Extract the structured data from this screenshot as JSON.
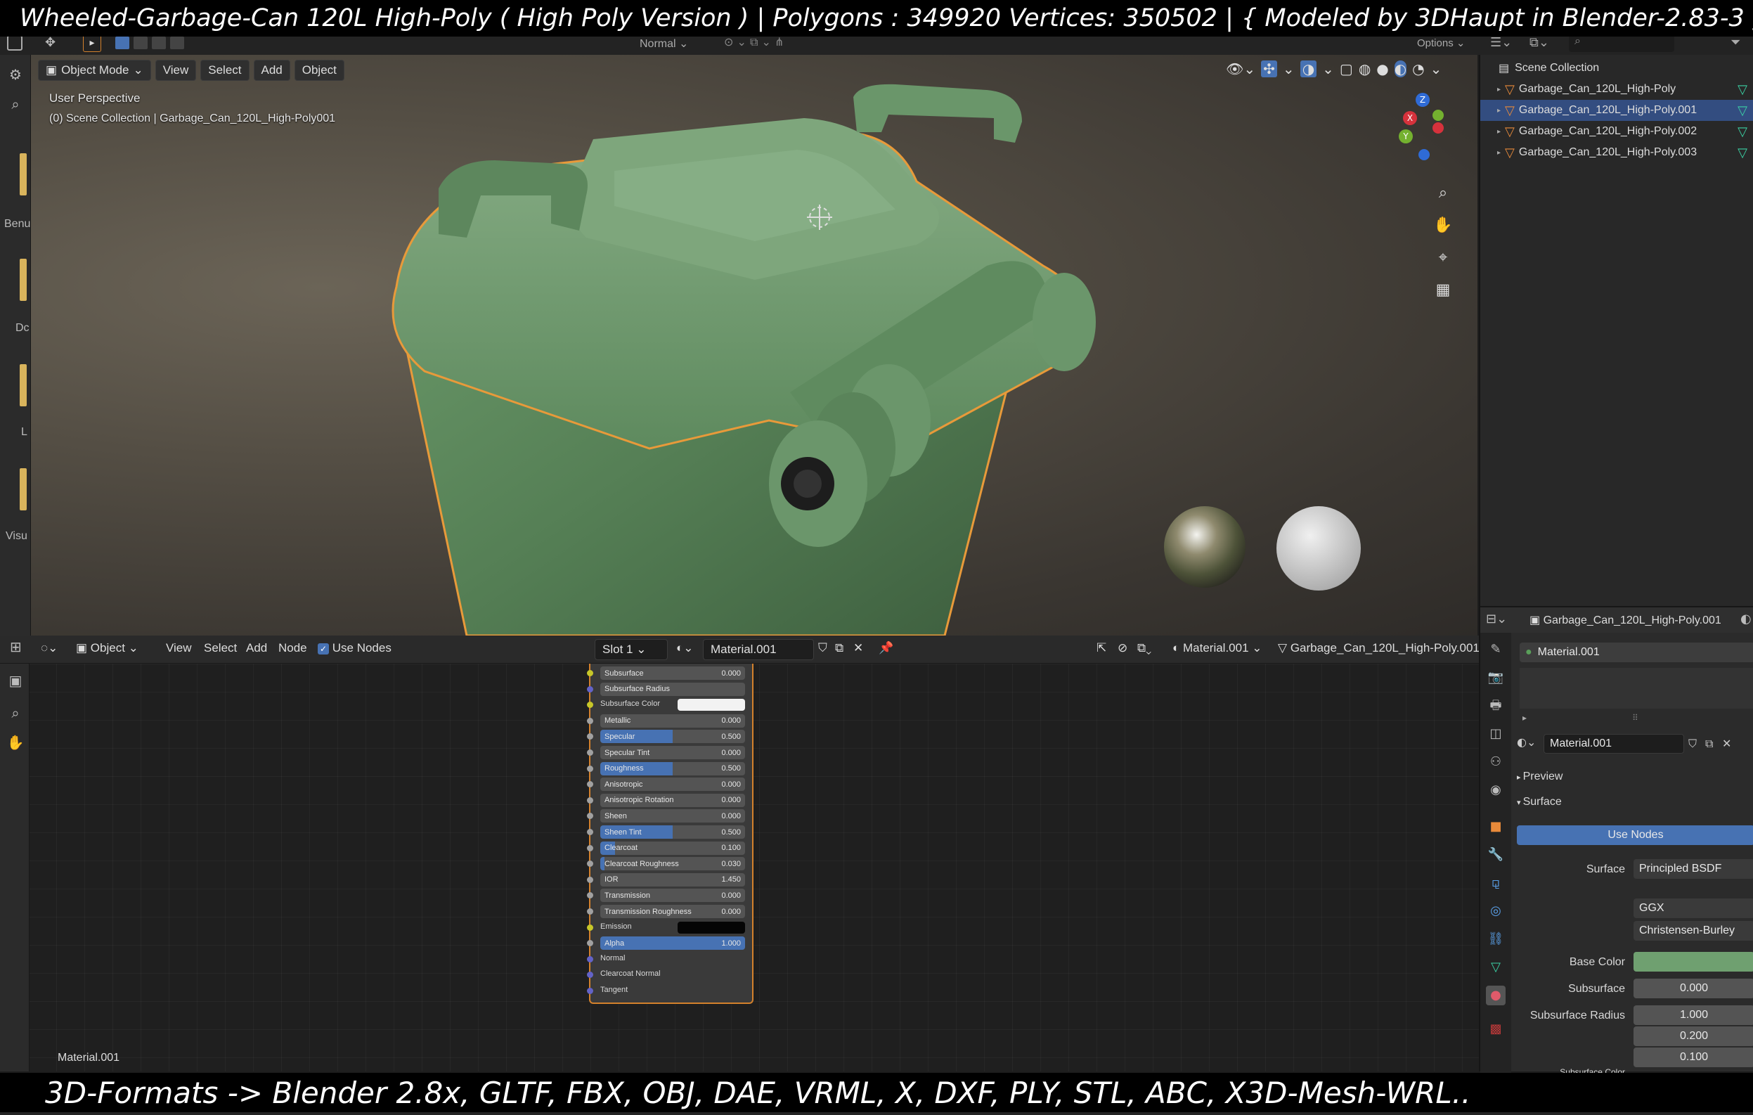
{
  "overlay": {
    "top_caption": "Wheeled-Garbage-Can 120L High-Poly ( High Poly Version )  |   Polygons : 349920   Vertices: 350502     |     { Modeled by 3DHaupt in Blender-2.83-3 }",
    "bottom_caption": "3D-Formats -> Blender 2.8x, GLTF, FBX, OBJ, DAE, VRML, X, DXF, PLY, STL, ABC, X3D-Mesh-WRL.."
  },
  "topbar": {
    "orientation": "Normal",
    "options": "Options"
  },
  "left_tabs": [
    "Benu",
    "Dc",
    "L",
    "Visu"
  ],
  "viewport": {
    "mode": "Object Mode",
    "menus": [
      "View",
      "Select",
      "Add",
      "Object"
    ],
    "perspective": "User Perspective",
    "collection_info": "(0) Scene Collection | Garbage_Can_120L_High-Poly001",
    "gizmo_axes": [
      "Z",
      "X",
      "Y"
    ]
  },
  "node_editor": {
    "editor_type": "Object",
    "menus": [
      "View",
      "Select",
      "Add",
      "Node"
    ],
    "use_nodes_label": "Use Nodes",
    "use_nodes_checked": true,
    "slot": "Slot 1",
    "material": "Material.001",
    "material_right": "Material.001",
    "object_right": "Garbage_Can_120L_High-Poly.001",
    "footer_label": "Material.001",
    "bsdf_rows": [
      {
        "label": "Subsurface",
        "value": "0.000",
        "fill": 0,
        "type": "slider",
        "socket": "#c7c729"
      },
      {
        "label": "Subsurface Radius",
        "value": "",
        "fill": 0,
        "type": "dropdown",
        "socket": "#6363c7"
      },
      {
        "label": "Subsurface Color",
        "value": "",
        "fill": 0,
        "type": "color",
        "swatch": "#f2f2f2",
        "socket": "#c7c729"
      },
      {
        "label": "Metallic",
        "value": "0.000",
        "fill": 0,
        "type": "slider",
        "socket": "#a1a1a1"
      },
      {
        "label": "Specular",
        "value": "0.500",
        "fill": 0.5,
        "type": "slider",
        "socket": "#a1a1a1"
      },
      {
        "label": "Specular Tint",
        "value": "0.000",
        "fill": 0,
        "type": "slider",
        "socket": "#a1a1a1"
      },
      {
        "label": "Roughness",
        "value": "0.500",
        "fill": 0.5,
        "type": "slider",
        "socket": "#a1a1a1"
      },
      {
        "label": "Anisotropic",
        "value": "0.000",
        "fill": 0,
        "type": "slider",
        "socket": "#a1a1a1"
      },
      {
        "label": "Anisotropic Rotation",
        "value": "0.000",
        "fill": 0,
        "type": "slider",
        "socket": "#a1a1a1"
      },
      {
        "label": "Sheen",
        "value": "0.000",
        "fill": 0,
        "type": "slider",
        "socket": "#a1a1a1"
      },
      {
        "label": "Sheen Tint",
        "value": "0.500",
        "fill": 0.5,
        "type": "slider",
        "socket": "#a1a1a1"
      },
      {
        "label": "Clearcoat",
        "value": "0.100",
        "fill": 0.1,
        "type": "slider",
        "socket": "#a1a1a1"
      },
      {
        "label": "Clearcoat Roughness",
        "value": "0.030",
        "fill": 0.03,
        "type": "slider",
        "socket": "#a1a1a1"
      },
      {
        "label": "IOR",
        "value": "1.450",
        "fill": 0,
        "type": "slider",
        "socket": "#a1a1a1"
      },
      {
        "label": "Transmission",
        "value": "0.000",
        "fill": 0,
        "type": "slider",
        "socket": "#a1a1a1"
      },
      {
        "label": "Transmission Roughness",
        "value": "0.000",
        "fill": 0,
        "type": "slider",
        "socket": "#a1a1a1"
      },
      {
        "label": "Emission",
        "value": "",
        "fill": 0,
        "type": "color",
        "swatch": "#050505",
        "socket": "#c7c729"
      },
      {
        "label": "Alpha",
        "value": "1.000",
        "fill": 1,
        "type": "slider",
        "socket": "#a1a1a1"
      },
      {
        "label": "Normal",
        "value": "",
        "fill": 0,
        "type": "socket",
        "socket": "#6363c7"
      },
      {
        "label": "Clearcoat Normal",
        "value": "",
        "fill": 0,
        "type": "socket",
        "socket": "#6363c7"
      },
      {
        "label": "Tangent",
        "value": "",
        "fill": 0,
        "type": "socket",
        "socket": "#6363c7"
      }
    ]
  },
  "outliner": {
    "root": "Scene Collection",
    "items": [
      {
        "name": "Garbage_Can_120L_High-Poly",
        "selected": false
      },
      {
        "name": "Garbage_Can_120L_High-Poly.001",
        "selected": true
      },
      {
        "name": "Garbage_Can_120L_High-Poly.002",
        "selected": false
      },
      {
        "name": "Garbage_Can_120L_High-Poly.003",
        "selected": false
      }
    ]
  },
  "properties": {
    "object_name": "Garbage_Can_120L_High-Poly.001",
    "slot_material": "Material.001",
    "material_name": "Material.001",
    "preview_label": "Preview",
    "surface_section": "Surface",
    "use_nodes_button": "Use Nodes",
    "surface_label": "Surface",
    "surface_value": "Principled BSDF",
    "distribution": "GGX",
    "subsurface_method": "Christensen-Burley",
    "base_color_label": "Base Color",
    "base_color": "#6fa070",
    "subsurface_label": "Subsurface",
    "subsurface_value": "0.000",
    "subsurface_radius_label": "Subsurface Radius",
    "subsurface_radius": [
      "1.000",
      "0.200",
      "0.100"
    ],
    "cutoff_label": "Subsurface Color"
  },
  "colors": {
    "accent_blue": "#4772b3",
    "selection_orange": "#d4812c",
    "can_green": "#5f8a60"
  }
}
